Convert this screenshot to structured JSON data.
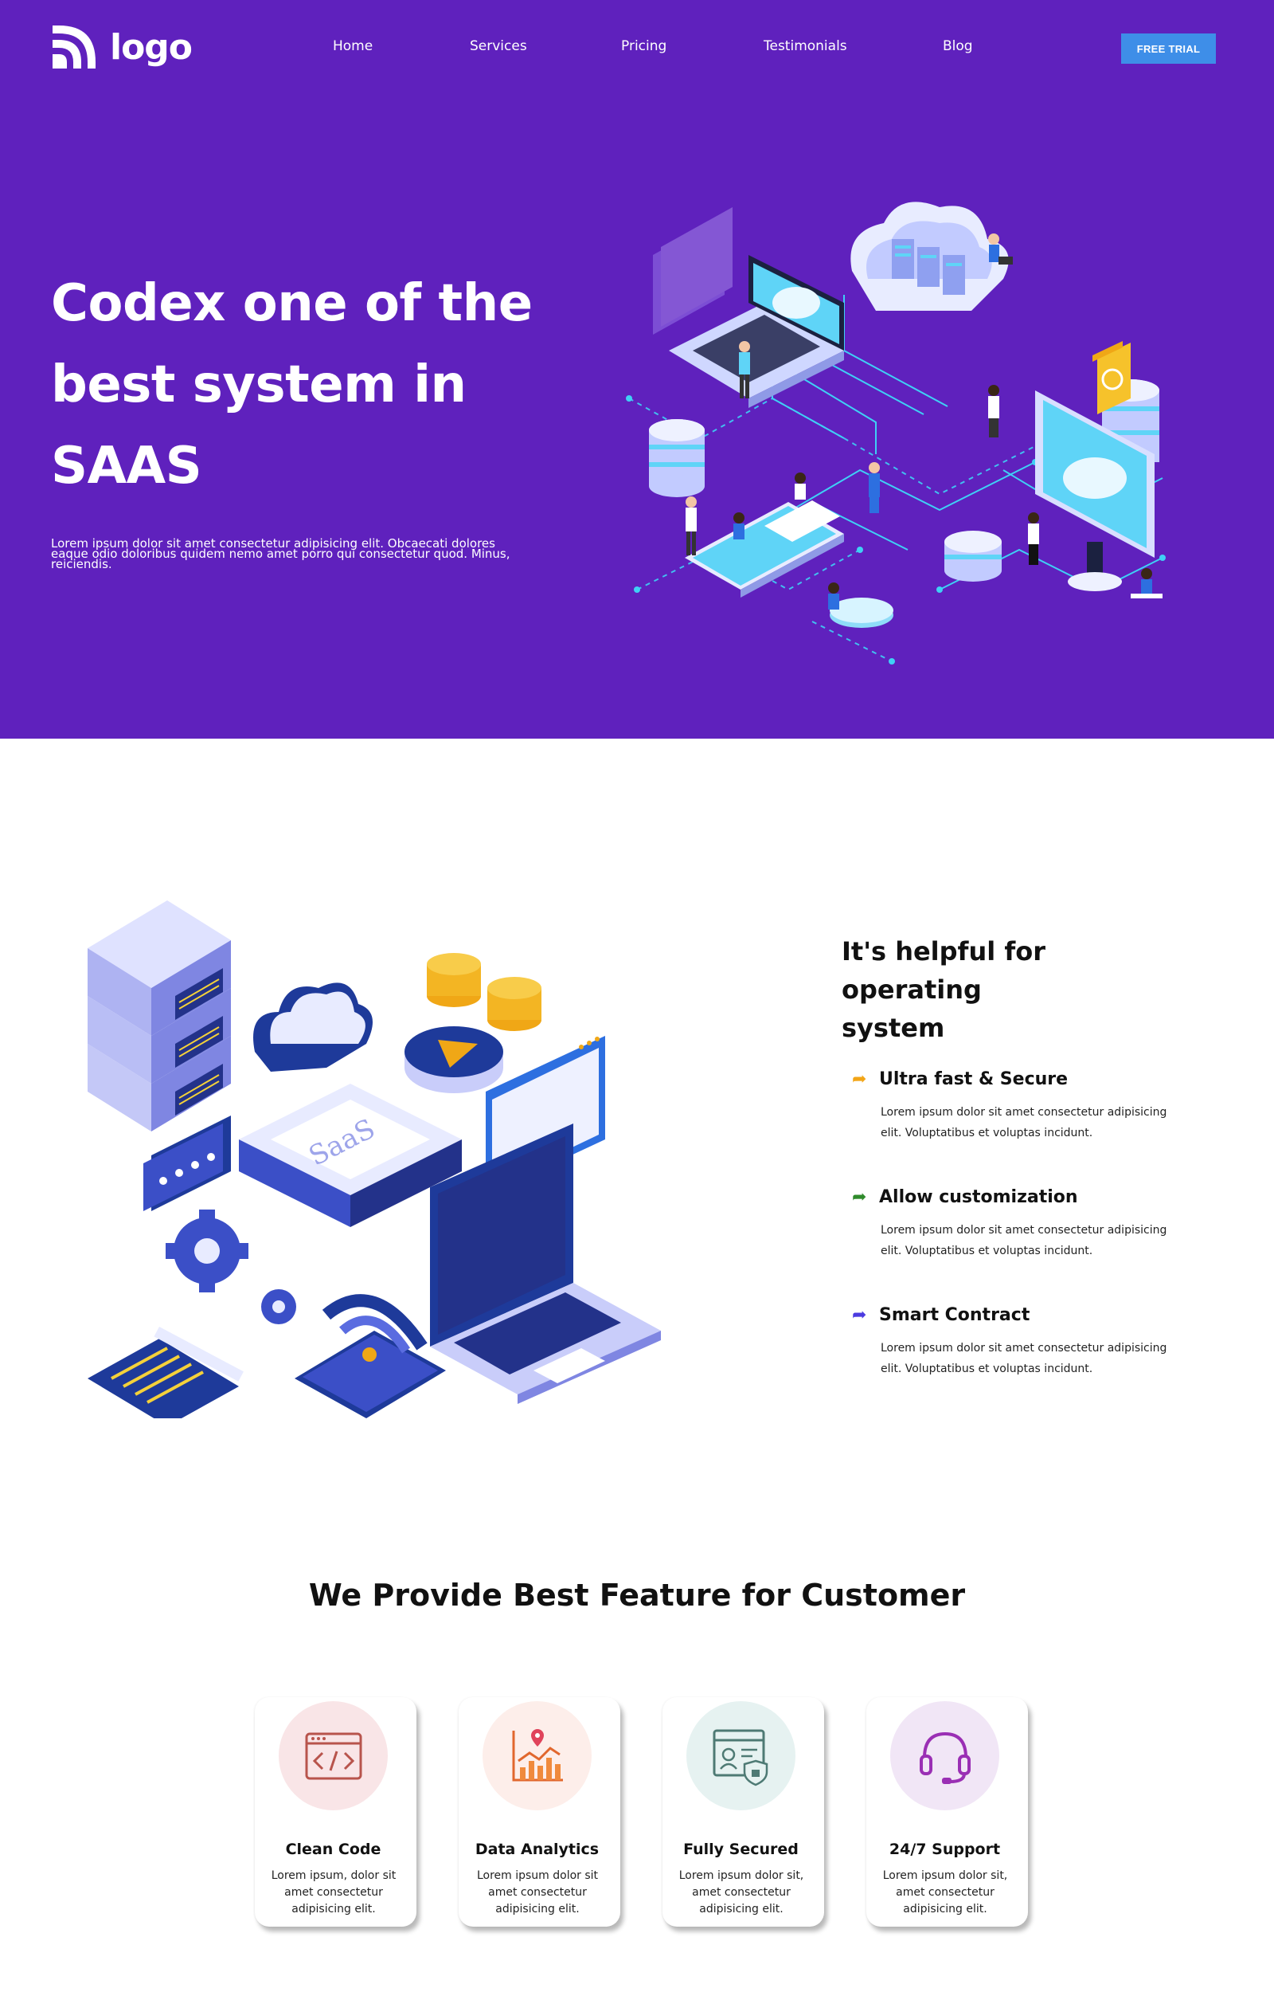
{
  "nav": {
    "logo_text": "logo",
    "links": [
      "Home",
      "Services",
      "Pricing",
      "Testimonials",
      "Blog"
    ],
    "cta_label": "FREE TRIAL"
  },
  "hero": {
    "title_lines": [
      "Codex one of the",
      "best system in",
      "SAAS"
    ],
    "body": "Lorem ipsum dolor sit amet consectetur adipisicing elit. Obcaecati dolores eaque odio doloribus quidem nemo amet porro qui consectetur quod. Minus, reiciendis."
  },
  "helpful": {
    "title_lines": [
      "It's helpful for operating",
      "system"
    ],
    "features": [
      {
        "title": "Ultra fast & Secure",
        "text": "Lorem ipsum dolor sit amet consectetur adipisicing elit. Voluptatibus et voluptas incidunt.",
        "arrow_color": "#f2a516"
      },
      {
        "title": "Allow customization",
        "text": "Lorem ipsum dolor sit amet consectetur adipisicing elit. Voluptatibus et voluptas incidunt.",
        "arrow_color": "#2f8a2b"
      },
      {
        "title": "Smart Contract",
        "text": "Lorem ipsum dolor sit amet consectetur adipisicing elit. Voluptatibus et voluptas incidunt.",
        "arrow_color": "#4b3be0"
      }
    ],
    "illustration_text": "SaaS"
  },
  "features_section": {
    "title": "We Provide Best Feature for Customer",
    "cards": [
      {
        "title": "Clean Code",
        "text": "Lorem ipsum, dolor sit amet consectetur adipisicing elit.",
        "icon": "code-window-icon",
        "circle_color": "#f9e5e7"
      },
      {
        "title": "Data Analytics",
        "text": "Lorem ipsum dolor sit amet consectetur adipisicing elit.",
        "icon": "analytics-chart-icon",
        "circle_color": "#fdeeea"
      },
      {
        "title": "Fully Secured",
        "text": "Lorem ipsum dolor sit, amet consectetur adipisicing elit.",
        "icon": "secure-shield-icon",
        "circle_color": "#e6f2f1"
      },
      {
        "title": "24/7 Support",
        "text": "Lorem ipsum dolor sit, amet consectetur adipisicing elit.",
        "icon": "headset-icon",
        "circle_color": "#f1e6f6"
      }
    ]
  },
  "colors": {
    "hero_bg": "#5f21bd",
    "cta_bg": "#3e8ee8"
  }
}
